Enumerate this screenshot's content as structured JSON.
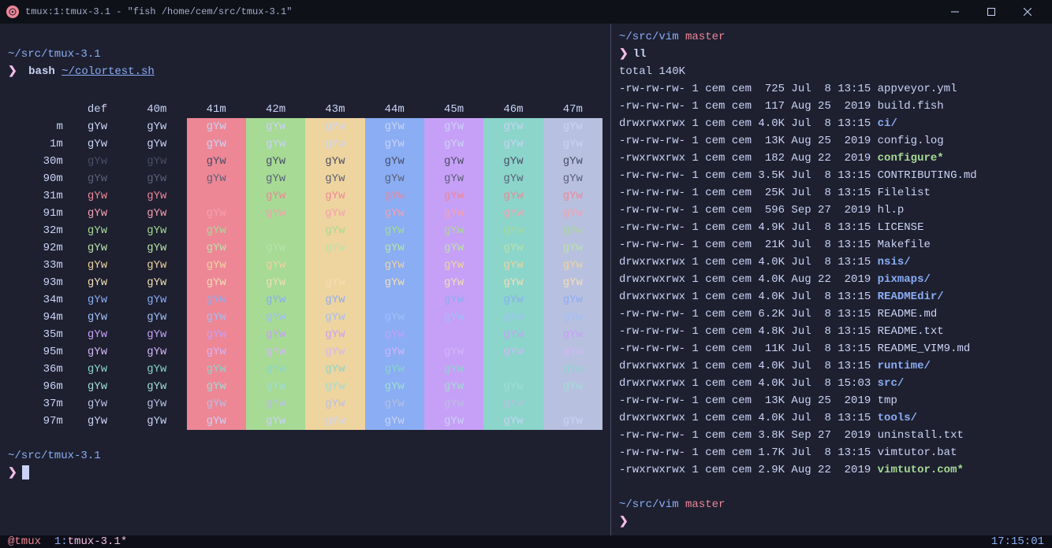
{
  "window": {
    "title": "tmux:1:tmux-3.1 - \"fish /home/cem/src/tmux-3.1\""
  },
  "left_pane": {
    "path": "~/src/tmux-3.1",
    "cmd_prefix": "bash",
    "cmd_file": "~/colortest.sh",
    "headers": [
      "",
      "def",
      "40m",
      "41m",
      "42m",
      "43m",
      "44m",
      "45m",
      "46m",
      "47m"
    ],
    "sample": "gYw",
    "rows": [
      {
        "lbl": "m",
        "fg": "fg-def",
        "bold": false
      },
      {
        "lbl": "1m",
        "fg": "fg-def",
        "bold": true
      },
      {
        "lbl": "30m",
        "fg": "fg-30",
        "bold": false
      },
      {
        "lbl": "90m",
        "fg": "fg-90",
        "bold": false
      },
      {
        "lbl": "31m",
        "fg": "fg-31",
        "bold": false
      },
      {
        "lbl": "91m",
        "fg": "fg-91",
        "bold": false
      },
      {
        "lbl": "32m",
        "fg": "fg-32",
        "bold": false
      },
      {
        "lbl": "92m",
        "fg": "fg-92",
        "bold": false
      },
      {
        "lbl": "33m",
        "fg": "fg-33",
        "bold": false
      },
      {
        "lbl": "93m",
        "fg": "fg-93",
        "bold": false
      },
      {
        "lbl": "34m",
        "fg": "fg-34",
        "bold": false
      },
      {
        "lbl": "94m",
        "fg": "fg-94",
        "bold": false
      },
      {
        "lbl": "35m",
        "fg": "fg-35",
        "bold": false
      },
      {
        "lbl": "95m",
        "fg": "fg-95",
        "bold": false
      },
      {
        "lbl": "36m",
        "fg": "fg-36",
        "bold": false
      },
      {
        "lbl": "96m",
        "fg": "fg-96",
        "bold": false
      },
      {
        "lbl": "37m",
        "fg": "fg-37",
        "bold": false
      },
      {
        "lbl": "97m",
        "fg": "fg-97",
        "bold": false
      }
    ],
    "bg_cols": [
      "",
      "",
      "bg-41",
      "bg-42",
      "bg-43",
      "bg-44",
      "bg-45",
      "bg-46",
      "bg-47"
    ]
  },
  "right_pane": {
    "path": "~/src/vim",
    "branch": "master",
    "cmd": "ll",
    "total": "total 140K",
    "entries": [
      {
        "perm": "-rw-rw-rw-",
        "links": "1",
        "user": "cem",
        "group": "cem",
        "size": "725",
        "date": "Jul  8 13:15",
        "name": "appveyor.yml",
        "cls": ""
      },
      {
        "perm": "-rw-rw-rw-",
        "links": "1",
        "user": "cem",
        "group": "cem",
        "size": "117",
        "date": "Aug 25  2019",
        "name": "build.fish",
        "cls": ""
      },
      {
        "perm": "drwxrwxrwx",
        "links": "1",
        "user": "cem",
        "group": "cem",
        "size": "4.0K",
        "date": "Jul  8 13:15",
        "name": "ci/",
        "cls": "dir"
      },
      {
        "perm": "-rw-rw-rw-",
        "links": "1",
        "user": "cem",
        "group": "cem",
        "size": "13K",
        "date": "Aug 25  2019",
        "name": "config.log",
        "cls": ""
      },
      {
        "perm": "-rwxrwxrwx",
        "links": "1",
        "user": "cem",
        "group": "cem",
        "size": "182",
        "date": "Aug 22  2019",
        "name": "configure*",
        "cls": "exe"
      },
      {
        "perm": "-rw-rw-rw-",
        "links": "1",
        "user": "cem",
        "group": "cem",
        "size": "3.5K",
        "date": "Jul  8 13:15",
        "name": "CONTRIBUTING.md",
        "cls": ""
      },
      {
        "perm": "-rw-rw-rw-",
        "links": "1",
        "user": "cem",
        "group": "cem",
        "size": "25K",
        "date": "Jul  8 13:15",
        "name": "Filelist",
        "cls": ""
      },
      {
        "perm": "-rw-rw-rw-",
        "links": "1",
        "user": "cem",
        "group": "cem",
        "size": "596",
        "date": "Sep 27  2019",
        "name": "hl.p",
        "cls": ""
      },
      {
        "perm": "-rw-rw-rw-",
        "links": "1",
        "user": "cem",
        "group": "cem",
        "size": "4.9K",
        "date": "Jul  8 13:15",
        "name": "LICENSE",
        "cls": ""
      },
      {
        "perm": "-rw-rw-rw-",
        "links": "1",
        "user": "cem",
        "group": "cem",
        "size": "21K",
        "date": "Jul  8 13:15",
        "name": "Makefile",
        "cls": ""
      },
      {
        "perm": "drwxrwxrwx",
        "links": "1",
        "user": "cem",
        "group": "cem",
        "size": "4.0K",
        "date": "Jul  8 13:15",
        "name": "nsis/",
        "cls": "dir"
      },
      {
        "perm": "drwxrwxrwx",
        "links": "1",
        "user": "cem",
        "group": "cem",
        "size": "4.0K",
        "date": "Aug 22  2019",
        "name": "pixmaps/",
        "cls": "dir"
      },
      {
        "perm": "drwxrwxrwx",
        "links": "1",
        "user": "cem",
        "group": "cem",
        "size": "4.0K",
        "date": "Jul  8 13:15",
        "name": "READMEdir/",
        "cls": "dir"
      },
      {
        "perm": "-rw-rw-rw-",
        "links": "1",
        "user": "cem",
        "group": "cem",
        "size": "6.2K",
        "date": "Jul  8 13:15",
        "name": "README.md",
        "cls": ""
      },
      {
        "perm": "-rw-rw-rw-",
        "links": "1",
        "user": "cem",
        "group": "cem",
        "size": "4.8K",
        "date": "Jul  8 13:15",
        "name": "README.txt",
        "cls": ""
      },
      {
        "perm": "-rw-rw-rw-",
        "links": "1",
        "user": "cem",
        "group": "cem",
        "size": "11K",
        "date": "Jul  8 13:15",
        "name": "README_VIM9.md",
        "cls": ""
      },
      {
        "perm": "drwxrwxrwx",
        "links": "1",
        "user": "cem",
        "group": "cem",
        "size": "4.0K",
        "date": "Jul  8 13:15",
        "name": "runtime/",
        "cls": "dir"
      },
      {
        "perm": "drwxrwxrwx",
        "links": "1",
        "user": "cem",
        "group": "cem",
        "size": "4.0K",
        "date": "Jul  8 15:03",
        "name": "src/",
        "cls": "dir"
      },
      {
        "perm": "-rw-rw-rw-",
        "links": "1",
        "user": "cem",
        "group": "cem",
        "size": "13K",
        "date": "Aug 25  2019",
        "name": "tmp",
        "cls": ""
      },
      {
        "perm": "drwxrwxrwx",
        "links": "1",
        "user": "cem",
        "group": "cem",
        "size": "4.0K",
        "date": "Jul  8 13:15",
        "name": "tools/",
        "cls": "dir"
      },
      {
        "perm": "-rw-rw-rw-",
        "links": "1",
        "user": "cem",
        "group": "cem",
        "size": "3.8K",
        "date": "Sep 27  2019",
        "name": "uninstall.txt",
        "cls": ""
      },
      {
        "perm": "-rw-rw-rw-",
        "links": "1",
        "user": "cem",
        "group": "cem",
        "size": "1.7K",
        "date": "Jul  8 13:15",
        "name": "vimtutor.bat",
        "cls": ""
      },
      {
        "perm": "-rwxrwxrwx",
        "links": "1",
        "user": "cem",
        "group": "cem",
        "size": "2.9K",
        "date": "Aug 22  2019",
        "name": "vimtutor.com*",
        "cls": "exe"
      }
    ]
  },
  "status": {
    "host": "@tmux",
    "win_idx": "1:",
    "win_name": "tmux-3.1*",
    "clock": "17:15:01"
  }
}
